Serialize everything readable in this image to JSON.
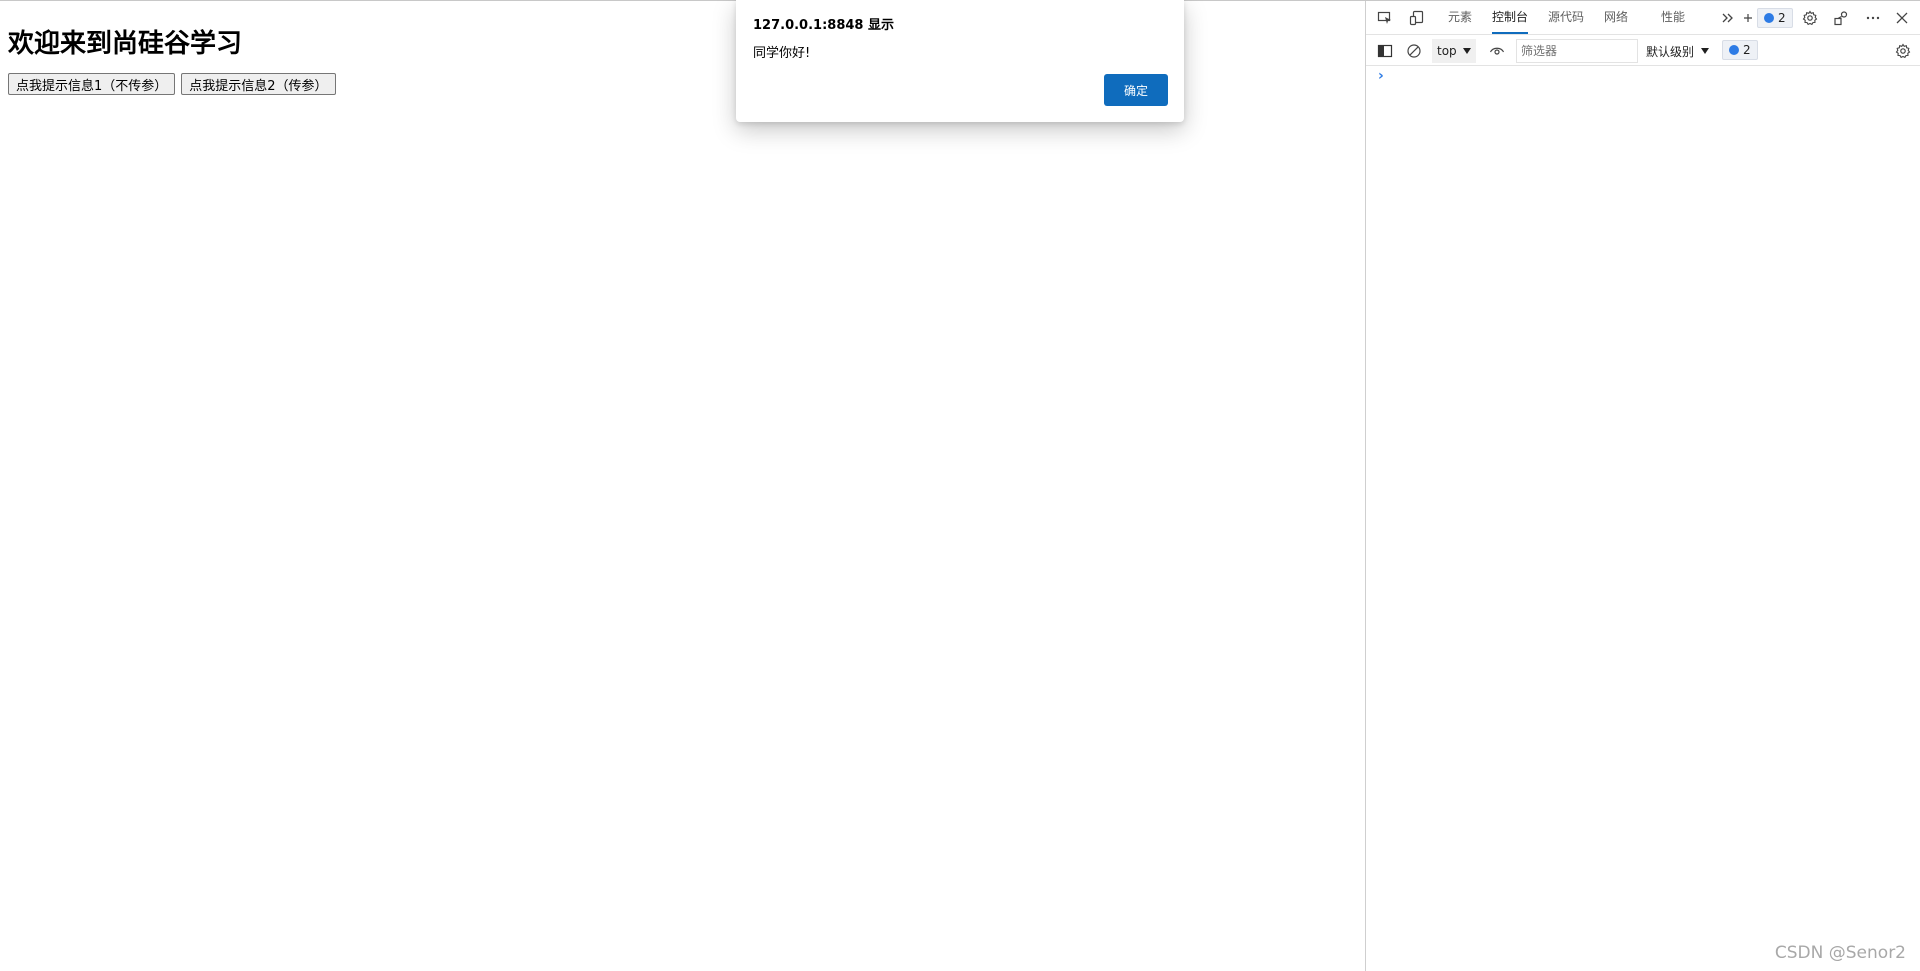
{
  "page": {
    "title": "欢迎来到尚硅谷学习",
    "button1_label": "点我提示信息1（不传参）",
    "button2_label": "点我提示信息2（传参）"
  },
  "dialog": {
    "title": "127.0.0.1:8848 显示",
    "message": "同学你好!",
    "ok_label": "确定"
  },
  "devtools": {
    "tabs": [
      {
        "label": "元素",
        "active": false
      },
      {
        "label": "控制台",
        "active": true
      },
      {
        "label": "源代码",
        "active": false
      },
      {
        "label": "网络",
        "active": false
      },
      {
        "label": "性能",
        "active": false
      }
    ],
    "issues_count": "2",
    "console": {
      "context": "top",
      "filter_placeholder": "筛选器",
      "level_label": "默认级别",
      "issues_count": "2",
      "prompt": "›"
    },
    "colors": {
      "accent": "#0f6cbd",
      "issue_blue": "#2d7be5"
    }
  },
  "watermark": "CSDN @Senor2"
}
